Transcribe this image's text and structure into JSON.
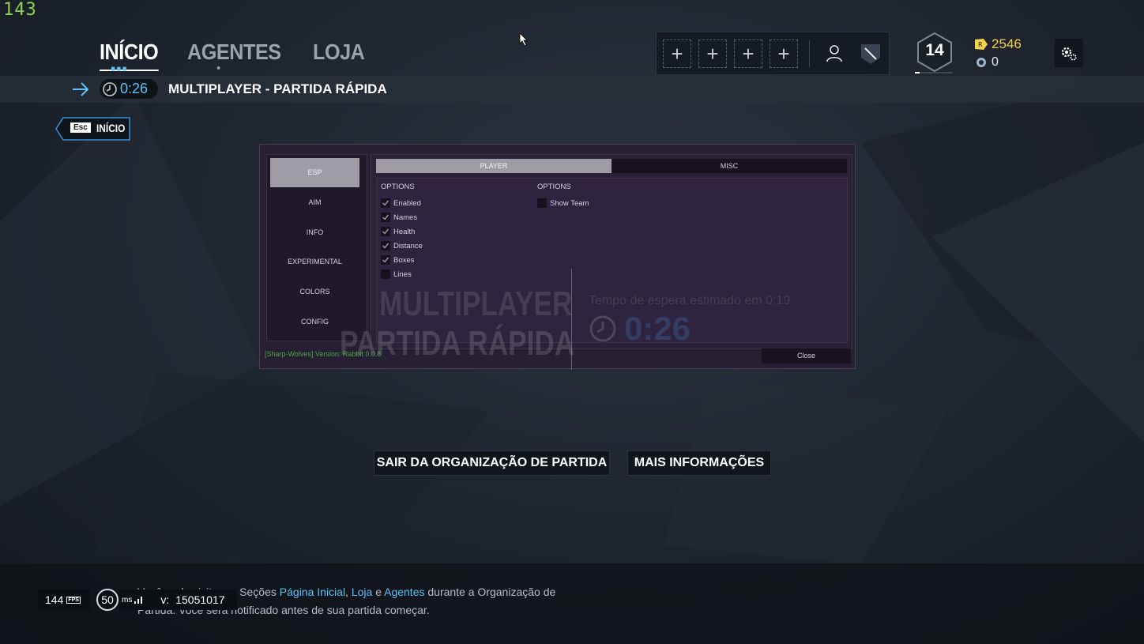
{
  "overlay": {
    "fps_counter": "143"
  },
  "nav": {
    "tabs": [
      {
        "label": "INÍCIO",
        "active": true
      },
      {
        "label": "AGENTES",
        "active": false
      },
      {
        "label": "LOJA",
        "active": false
      }
    ]
  },
  "squad": {
    "slots": [
      "+",
      "+",
      "+",
      "+"
    ]
  },
  "profile": {
    "level": "14",
    "renown": "2546",
    "credits": "0"
  },
  "status": {
    "timer": "0:26",
    "title": "MULTIPLAYER - PARTIDA RÁPIDA"
  },
  "back": {
    "key": "Esc",
    "label": "INÍCIO"
  },
  "menu": {
    "sidebar": [
      "ESP",
      "AIM",
      "INFO",
      "EXPERIMENTAL",
      "COLORS",
      "CONFIG"
    ],
    "active_sidebar": "ESP",
    "tabs": [
      {
        "label": "PLAYER",
        "active": true
      },
      {
        "label": "MISC",
        "active": false
      }
    ],
    "col1": {
      "header": "OPTIONS",
      "options": [
        {
          "label": "Enabled",
          "checked": true
        },
        {
          "label": "Names",
          "checked": true
        },
        {
          "label": "Health",
          "checked": true
        },
        {
          "label": "Distance",
          "checked": true
        },
        {
          "label": "Boxes",
          "checked": true
        },
        {
          "label": "Lines",
          "checked": false
        }
      ]
    },
    "col2": {
      "header": "OPTIONS",
      "options": [
        {
          "label": "Show Team",
          "checked": false
        }
      ]
    },
    "version": "[Sharp-Wolves] Version: Rabbit 0.0.8",
    "close": "Close"
  },
  "watermark": {
    "line1": "MULTIPLAYER",
    "line2": "PARTIDA RÁPIDA",
    "wait": "Tempo de espera estimado em 0:19",
    "timer": "0:26"
  },
  "buttons": {
    "leave": "SAIR DA ORGANIZAÇÃO DE PARTIDA",
    "more": "MAIS INFORMAÇÕES"
  },
  "footer": {
    "fps": "144",
    "fps_unit": "FPS",
    "ping": "50",
    "ping_unit": "ms",
    "version_label": "v:",
    "version": "15051017",
    "info_a": "Você pode visitar as Seções ",
    "link1": "Página Inicial",
    "sep1": ", ",
    "link2": "Loja",
    "sep2": " e ",
    "link3": "Agentes",
    "info_b": " durante a Organização de Partida. Você será notificado antes de sua partida começar."
  },
  "colors": {
    "accent": "#5bc0f8",
    "renown": "#f4d14a",
    "version_green": "#4fa34b"
  }
}
